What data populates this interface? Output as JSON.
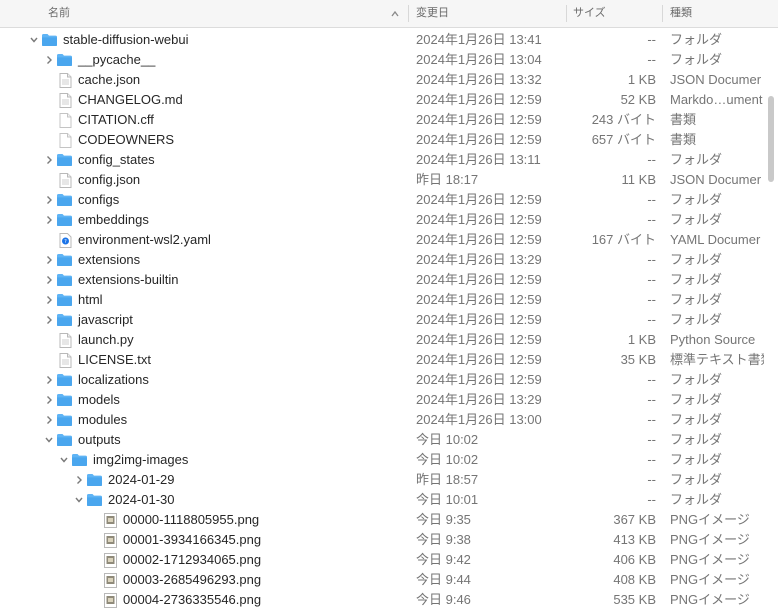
{
  "header": {
    "name": "名前",
    "date": "変更日",
    "size": "サイズ",
    "kind": "種類"
  },
  "rows": [
    {
      "level": 0,
      "expand": "down",
      "icon": "folder",
      "name": "stable-diffusion-webui",
      "date": "2024年1月26日 13:41",
      "size": "--",
      "kind": "フォルダ"
    },
    {
      "level": 1,
      "expand": "right",
      "icon": "folder",
      "name": "__pycache__",
      "date": "2024年1月26日 13:04",
      "size": "--",
      "kind": "フォルダ"
    },
    {
      "level": 1,
      "expand": "none",
      "icon": "doc",
      "name": "cache.json",
      "date": "2024年1月26日 13:32",
      "size": "1 KB",
      "kind": "JSON Documer"
    },
    {
      "level": 1,
      "expand": "none",
      "icon": "doc",
      "name": "CHANGELOG.md",
      "date": "2024年1月26日 12:59",
      "size": "52 KB",
      "kind": "Markdo…ument"
    },
    {
      "level": 1,
      "expand": "none",
      "icon": "blank",
      "name": "CITATION.cff",
      "date": "2024年1月26日 12:59",
      "size": "243 バイト",
      "kind": "書類"
    },
    {
      "level": 1,
      "expand": "none",
      "icon": "blank",
      "name": "CODEOWNERS",
      "date": "2024年1月26日 12:59",
      "size": "657 バイト",
      "kind": "書類"
    },
    {
      "level": 1,
      "expand": "right",
      "icon": "folder",
      "name": "config_states",
      "date": "2024年1月26日 13:11",
      "size": "--",
      "kind": "フォルダ"
    },
    {
      "level": 1,
      "expand": "none",
      "icon": "doc",
      "name": "config.json",
      "date": "昨日 18:17",
      "size": "11 KB",
      "kind": "JSON Documer"
    },
    {
      "level": 1,
      "expand": "right",
      "icon": "folder",
      "name": "configs",
      "date": "2024年1月26日 12:59",
      "size": "--",
      "kind": "フォルダ"
    },
    {
      "level": 1,
      "expand": "right",
      "icon": "folder",
      "name": "embeddings",
      "date": "2024年1月26日 12:59",
      "size": "--",
      "kind": "フォルダ"
    },
    {
      "level": 1,
      "expand": "none",
      "icon": "yaml",
      "name": "environment-wsl2.yaml",
      "date": "2024年1月26日 12:59",
      "size": "167 バイト",
      "kind": "YAML Documer"
    },
    {
      "level": 1,
      "expand": "right",
      "icon": "folder",
      "name": "extensions",
      "date": "2024年1月26日 13:29",
      "size": "--",
      "kind": "フォルダ"
    },
    {
      "level": 1,
      "expand": "right",
      "icon": "folder",
      "name": "extensions-builtin",
      "date": "2024年1月26日 12:59",
      "size": "--",
      "kind": "フォルダ"
    },
    {
      "level": 1,
      "expand": "right",
      "icon": "folder",
      "name": "html",
      "date": "2024年1月26日 12:59",
      "size": "--",
      "kind": "フォルダ"
    },
    {
      "level": 1,
      "expand": "right",
      "icon": "folder",
      "name": "javascript",
      "date": "2024年1月26日 12:59",
      "size": "--",
      "kind": "フォルダ"
    },
    {
      "level": 1,
      "expand": "none",
      "icon": "doc",
      "name": "launch.py",
      "date": "2024年1月26日 12:59",
      "size": "1 KB",
      "kind": "Python Source"
    },
    {
      "level": 1,
      "expand": "none",
      "icon": "doc",
      "name": "LICENSE.txt",
      "date": "2024年1月26日 12:59",
      "size": "35 KB",
      "kind": "標準テキスト書類"
    },
    {
      "level": 1,
      "expand": "right",
      "icon": "folder",
      "name": "localizations",
      "date": "2024年1月26日 12:59",
      "size": "--",
      "kind": "フォルダ"
    },
    {
      "level": 1,
      "expand": "right",
      "icon": "folder",
      "name": "models",
      "date": "2024年1月26日 13:29",
      "size": "--",
      "kind": "フォルダ"
    },
    {
      "level": 1,
      "expand": "right",
      "icon": "folder",
      "name": "modules",
      "date": "2024年1月26日 13:00",
      "size": "--",
      "kind": "フォルダ"
    },
    {
      "level": 1,
      "expand": "down",
      "icon": "folder",
      "name": "outputs",
      "date": "今日 10:02",
      "size": "--",
      "kind": "フォルダ"
    },
    {
      "level": 2,
      "expand": "down",
      "icon": "folder",
      "name": "img2img-images",
      "date": "今日 10:02",
      "size": "--",
      "kind": "フォルダ"
    },
    {
      "level": 3,
      "expand": "right",
      "icon": "folder",
      "name": "2024-01-29",
      "date": "昨日 18:57",
      "size": "--",
      "kind": "フォルダ"
    },
    {
      "level": 3,
      "expand": "down",
      "icon": "folder",
      "name": "2024-01-30",
      "date": "今日 10:01",
      "size": "--",
      "kind": "フォルダ"
    },
    {
      "level": 4,
      "expand": "none",
      "icon": "png",
      "name": "00000-1118805955.png",
      "date": "今日 9:35",
      "size": "367 KB",
      "kind": "PNGイメージ"
    },
    {
      "level": 4,
      "expand": "none",
      "icon": "png",
      "name": "00001-3934166345.png",
      "date": "今日 9:38",
      "size": "413 KB",
      "kind": "PNGイメージ"
    },
    {
      "level": 4,
      "expand": "none",
      "icon": "png",
      "name": "00002-1712934065.png",
      "date": "今日 9:42",
      "size": "406 KB",
      "kind": "PNGイメージ"
    },
    {
      "level": 4,
      "expand": "none",
      "icon": "png",
      "name": "00003-2685496293.png",
      "date": "今日 9:44",
      "size": "408 KB",
      "kind": "PNGイメージ"
    },
    {
      "level": 4,
      "expand": "none",
      "icon": "png",
      "name": "00004-2736335546.png",
      "date": "今日 9:46",
      "size": "535 KB",
      "kind": "PNGイメージ"
    }
  ],
  "icons": {
    "folder": "folder-icon",
    "doc": "document-icon",
    "blank": "blank-document-icon",
    "yaml": "yaml-document-icon",
    "png": "png-image-icon",
    "sort": "chevron-up-icon"
  },
  "colors": {
    "folder": "#5fb4f5",
    "accent": "#1a73e8"
  }
}
